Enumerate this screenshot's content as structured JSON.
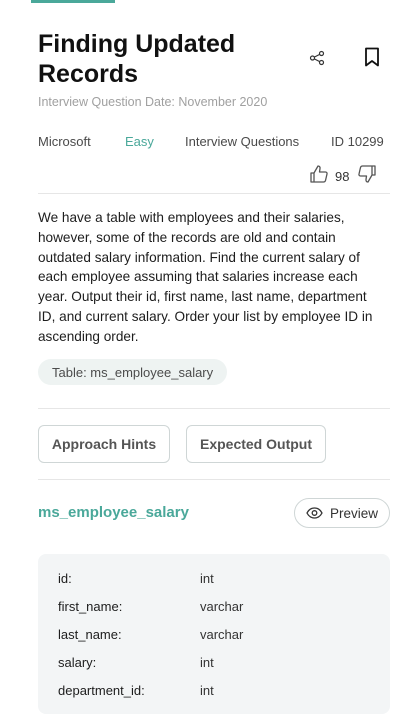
{
  "question": {
    "title": "Finding Updated Records",
    "date": "Interview Question Date: November 2020",
    "company": "Microsoft",
    "difficulty": "Easy",
    "category": "Interview Questions",
    "id_label": "ID 10299",
    "upvotes": "98",
    "description": "We have a table with employees and their salaries, however, some of the records are old and contain outdated salary information. Find the current salary of each employee assuming that salaries increase each year. Output their id, first name, last name, department ID, and current salary. Order your list by employee ID in ascending order.",
    "table_chip": "Table: ms_employee_salary"
  },
  "buttons": {
    "approach_hints": "Approach Hints",
    "expected_output": "Expected Output",
    "preview": "Preview"
  },
  "schema": {
    "table_name": "ms_employee_salary",
    "columns": [
      {
        "name": "id:",
        "type": "int"
      },
      {
        "name": "first_name:",
        "type": "varchar"
      },
      {
        "name": "last_name:",
        "type": "varchar"
      },
      {
        "name": "salary:",
        "type": "int"
      },
      {
        "name": "department_id:",
        "type": "int"
      }
    ]
  },
  "colors": {
    "accent": "#4aa89a",
    "chip_bg": "#eef3f2",
    "schema_bg": "#f3f5f6"
  },
  "icons": [
    "share-icon",
    "bookmark-icon",
    "thumbs-up-icon",
    "thumbs-down-icon",
    "eye-icon"
  ]
}
